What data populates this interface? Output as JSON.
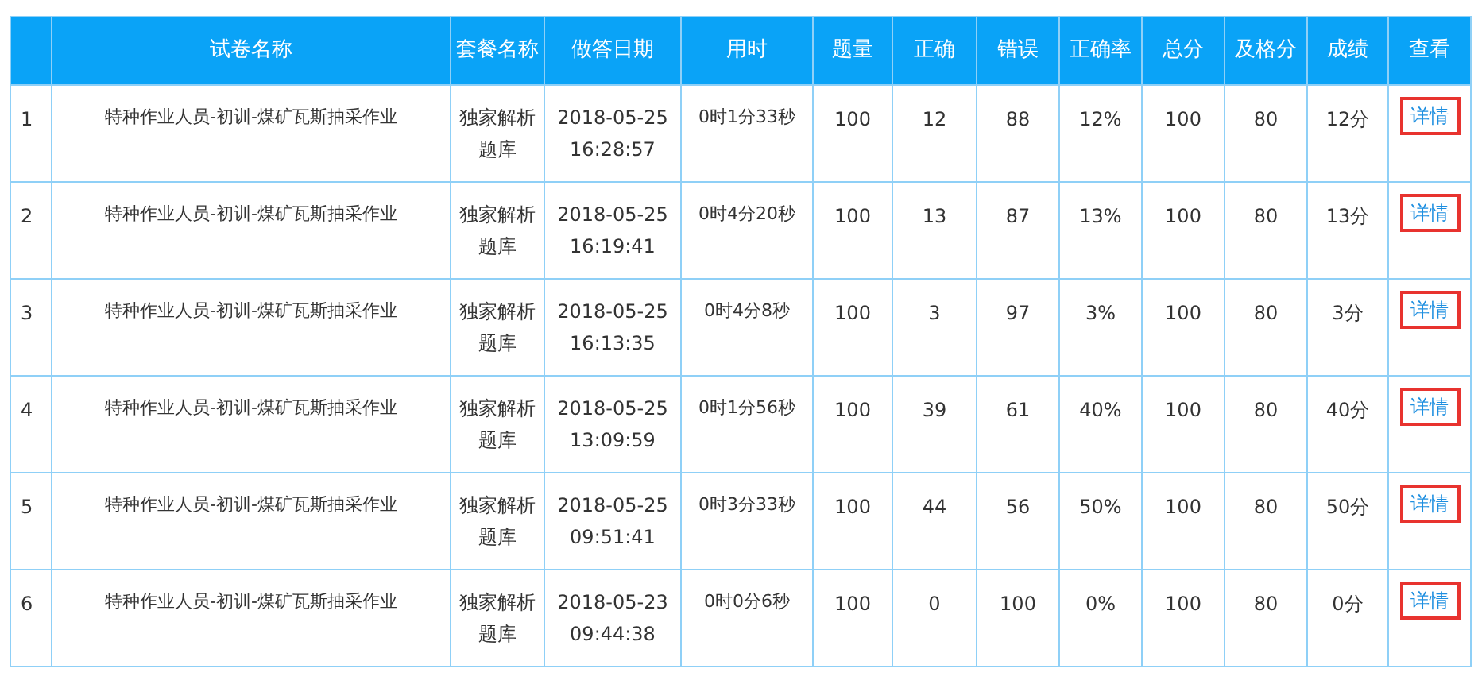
{
  "table": {
    "columns": [
      "",
      "试卷名称",
      "套餐名称",
      "做答日期",
      "用时",
      "题量",
      "正确",
      "错误",
      "正确率",
      "总分",
      "及格分",
      "成绩",
      "查看"
    ],
    "rows": [
      {
        "index": "1",
        "paper": "特种作业人员-初训-煤矿瓦斯抽采作业",
        "package": "独家解析题库",
        "date": "2018-05-25",
        "time": "16:28:57",
        "duration": "0时1分33秒",
        "count": "100",
        "correct": "12",
        "wrong": "88",
        "rate": "12%",
        "total": "100",
        "pass": "80",
        "score": "12分",
        "action": "详情"
      },
      {
        "index": "2",
        "paper": "特种作业人员-初训-煤矿瓦斯抽采作业",
        "package": "独家解析题库",
        "date": "2018-05-25",
        "time": "16:19:41",
        "duration": "0时4分20秒",
        "count": "100",
        "correct": "13",
        "wrong": "87",
        "rate": "13%",
        "total": "100",
        "pass": "80",
        "score": "13分",
        "action": "详情"
      },
      {
        "index": "3",
        "paper": "特种作业人员-初训-煤矿瓦斯抽采作业",
        "package": "独家解析题库",
        "date": "2018-05-25",
        "time": "16:13:35",
        "duration": "0时4分8秒",
        "count": "100",
        "correct": "3",
        "wrong": "97",
        "rate": "3%",
        "total": "100",
        "pass": "80",
        "score": "3分",
        "action": "详情"
      },
      {
        "index": "4",
        "paper": "特种作业人员-初训-煤矿瓦斯抽采作业",
        "package": "独家解析题库",
        "date": "2018-05-25",
        "time": "13:09:59",
        "duration": "0时1分56秒",
        "count": "100",
        "correct": "39",
        "wrong": "61",
        "rate": "40%",
        "total": "100",
        "pass": "80",
        "score": "40分",
        "action": "详情"
      },
      {
        "index": "5",
        "paper": "特种作业人员-初训-煤矿瓦斯抽采作业",
        "package": "独家解析题库",
        "date": "2018-05-25",
        "time": "09:51:41",
        "duration": "0时3分33秒",
        "count": "100",
        "correct": "44",
        "wrong": "56",
        "rate": "50%",
        "total": "100",
        "pass": "80",
        "score": "50分",
        "action": "详情"
      },
      {
        "index": "6",
        "paper": "特种作业人员-初训-煤矿瓦斯抽采作业",
        "package": "独家解析题库",
        "date": "2018-05-23",
        "time": "09:44:38",
        "duration": "0时0分6秒",
        "count": "100",
        "correct": "0",
        "wrong": "100",
        "rate": "0%",
        "total": "100",
        "pass": "80",
        "score": "0分",
        "action": "详情"
      }
    ]
  }
}
